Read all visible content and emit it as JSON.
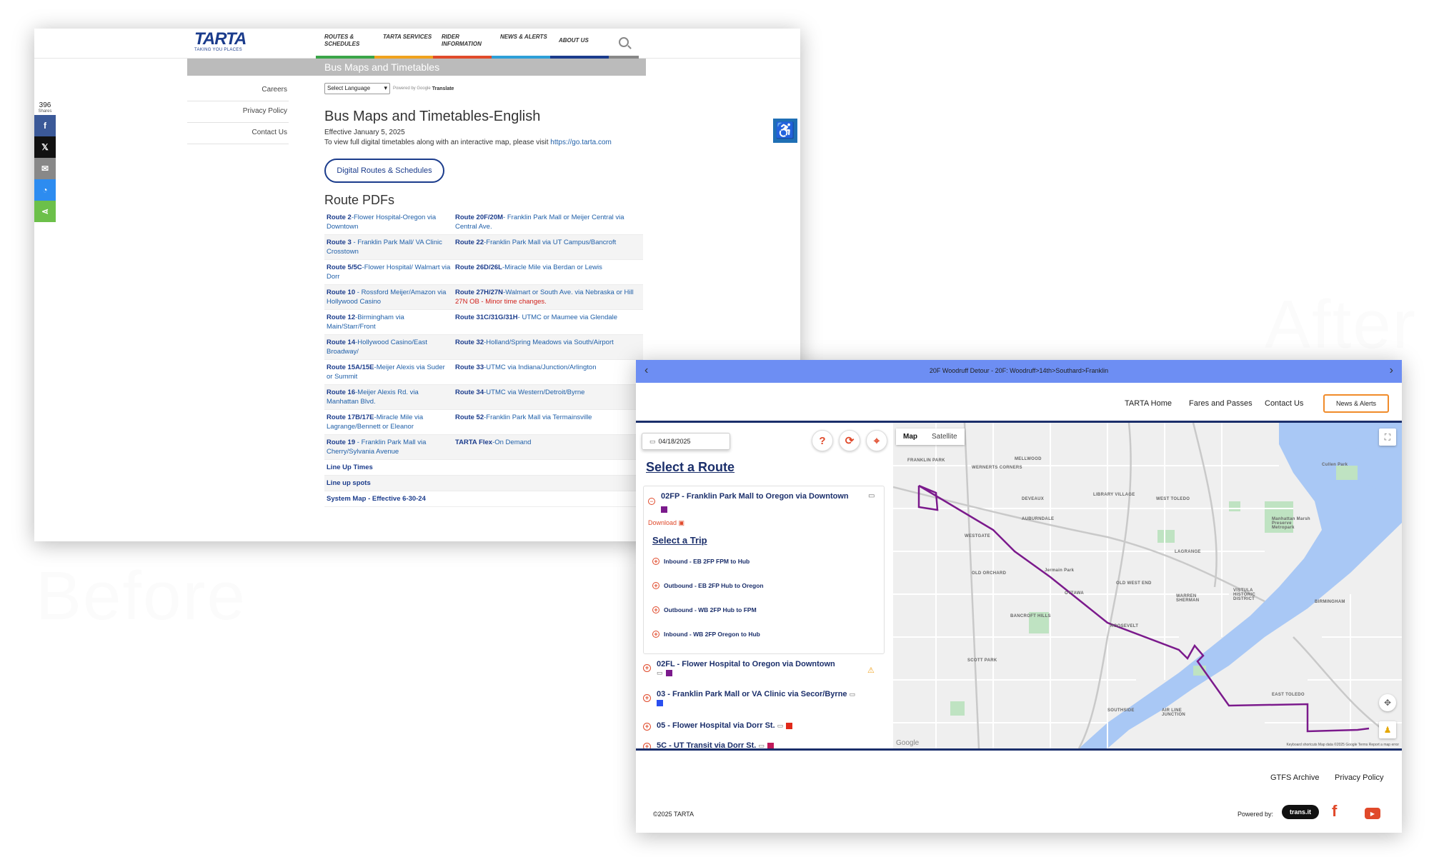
{
  "watermarks": {
    "before": "Before",
    "after": "After"
  },
  "before": {
    "logo": {
      "mark": "TARTA",
      "tagline": "TAKING YOU PLACES"
    },
    "nav": [
      {
        "label": "ROUTES & SCHEDULES"
      },
      {
        "label": "TARTA SERVICES"
      },
      {
        "label": "RIDER INFORMATION"
      },
      {
        "label": "NEWS & ALERTS"
      },
      {
        "label": "ABOUT US"
      }
    ],
    "banner": "Bus Maps and Timetables",
    "sidebar": [
      "Careers",
      "Privacy Policy",
      "Contact Us"
    ],
    "share": {
      "count": "396",
      "label": "Shares"
    },
    "language": {
      "select": "Select Language",
      "powered": "Powered by Google",
      "translate": "Translate"
    },
    "title": "Bus Maps and Timetables-English",
    "effective": "Effective January 5, 2025",
    "view_text": "To view full digital timetables along with an interactive map, please visit",
    "view_link": "https://go.tarta.com",
    "digital_button": "Digital Routes & Schedules",
    "pdfs_heading": "Route PDFs",
    "routes": [
      [
        {
          "code": "Route 2",
          "desc": "-Flower Hospital-Oregon via Downtown"
        },
        {
          "code": "Route 20F/20M",
          "desc": "- Franklin Park Mall or Meijer Central via Central Ave."
        }
      ],
      [
        {
          "code": "Route 3",
          "desc": " - Franklin Park Mall/ VA Clinic Crosstown"
        },
        {
          "code": "Route 22",
          "desc": "-Franklin Park Mall via UT Campus/Bancroft"
        }
      ],
      [
        {
          "code": "Route 5/5C",
          "desc": "-Flower Hospital/ Walmart via Dorr"
        },
        {
          "code": "Route 26D/26L",
          "desc": "-Miracle Mile via Berdan or Lewis"
        }
      ],
      [
        {
          "code": "Route 10",
          "desc": " - Rossford Meijer/Amazon via Hollywood Casino"
        },
        {
          "code": "Route 27H/27N",
          "desc": "-Walmart or South Ave. via Nebraska or Hill ",
          "note": "27N OB - Minor time changes."
        }
      ],
      [
        {
          "code": "Route 12",
          "desc": "-Birmingham via Main/Starr/Front"
        },
        {
          "code": "Route 31C/31G/31H",
          "desc": "- UTMC or Maumee via Glendale"
        }
      ],
      [
        {
          "code": "Route 14",
          "desc": "-Hollywood Casino/East Broadway/"
        },
        {
          "code": "Route 32",
          "desc": "-Holland/Spring Meadows via South/Airport"
        }
      ],
      [
        {
          "code": "Route 15A/15E",
          "desc": "-Meijer Alexis via Suder or Summit"
        },
        {
          "code": "Route 33",
          "desc": "-UTMC via Indiana/Junction/Arlington"
        }
      ],
      [
        {
          "code": "Route 16",
          "desc": "-Meijer Alexis Rd. via Manhattan Blvd."
        },
        {
          "code": "Route 34",
          "desc": "-UTMC via Western/Detroit/Byrne"
        }
      ],
      [
        {
          "code": "Route 17B/17E",
          "desc": "-Miracle Mile via Lagrange/Bennett or Eleanor"
        },
        {
          "code": "Route 52",
          "desc": "-Franklin Park Mall via Termainsville"
        }
      ],
      [
        {
          "code": "Route 19",
          "desc": " - Franklin Park Mall via Cherry/Sylvania Avenue"
        },
        {
          "code": "TARTA Flex",
          "desc": "-On Demand"
        }
      ]
    ],
    "extra_links": [
      "Line Up Times",
      "Line up spots",
      "System Map - Effective 6-30-24"
    ]
  },
  "after": {
    "alert": "20F Woodruff Detour - 20F: Woodruff>14th>Southard>Franklin",
    "nav": {
      "home": "TARTA Home",
      "fares": "Fares and Passes",
      "contact": "Contact Us",
      "news": "News & Alerts"
    },
    "date": "04/18/2025",
    "select_route": "Select a Route",
    "open_route": {
      "name": "02FP - Franklin Park Mall to Oregon via Downtown",
      "color": "#7b1a8c",
      "download": "Download"
    },
    "select_trip": "Select a Trip",
    "trips": [
      "Inbound - EB 2FP FPM to Hub",
      "Outbound - EB 2FP Hub to Oregon",
      "Outbound - WB 2FP Hub to FPM",
      "Inbound - WB 2FP Oregon to Hub"
    ],
    "route_items": [
      {
        "name": "02FL - Flower Hospital to Oregon via Downtown",
        "color": "#7b1a8c"
      },
      {
        "name": "03 - Franklin Park Mall or VA Clinic via Secor/Byrne",
        "color": "#2a4ff0"
      },
      {
        "name": "05 - Flower Hospital via Dorr St.",
        "color": "#e02a1a"
      },
      {
        "name": "5C - UT Transit via Dorr St.",
        "color": "#c01a5a"
      }
    ],
    "map": {
      "tab_map": "Map",
      "tab_satellite": "Satellite",
      "labels": {
        "franklin_park": "FRANKLIN PARK",
        "mellwood": "MELLWOOD",
        "wernerts": "WERNERTS CORNERS",
        "cullen": "Cullen Park",
        "deveaux": "DEVEAUX",
        "library": "LIBRARY VILLAGE",
        "west_toledo": "WEST TOLEDO",
        "auburndale": "AUBURNDALE",
        "westgate": "WESTGATE",
        "marsh": "Manhattan Marsh Preserve Metropark",
        "old_orchard": "OLD ORCHARD",
        "lagrange": "LAGRANGE",
        "ottawa": "OTTAWA",
        "old_west_end": "OLD WEST END",
        "jermain": "Jermain Park",
        "warren": "WARREN SHERMAN",
        "vistula": "VISTULA HISTORIC DISTRICT",
        "birmingham": "BIRMINGHAM",
        "bancroft": "BANCROFT HILLS",
        "roosevelt": "ROOSEVELT",
        "scott_park": "SCOTT PARK",
        "air_line": "AIR LINE JUNCTION",
        "east_toledo": "EAST TOLEDO",
        "southside": "SOUTHSIDE",
        "google": "Google"
      },
      "footer": "Keyboard shortcuts   Map data ©2025 Google   Terms   Report a map error",
      "route_color": "#7b1a8c"
    },
    "footer": {
      "gtfs": "GTFS Archive",
      "privacy": "Privacy Policy",
      "copyright": "©2025 TARTA",
      "powered": "Powered by:",
      "transit": "trans.it"
    }
  }
}
